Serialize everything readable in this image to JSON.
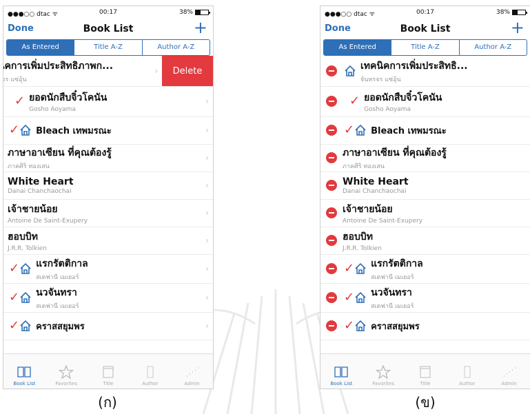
{
  "status": {
    "carrier": "●●●○○ dtac ᯤ",
    "time": "00:17",
    "battery": "38%",
    "battery_fraction": 0.38
  },
  "nav": {
    "done": "Done",
    "title": "Book List",
    "add": "+"
  },
  "segments": [
    "As Entered",
    "Title A-Z",
    "Author A-Z"
  ],
  "delete_label": "Delete",
  "screen_a": {
    "caption": "(ก)",
    "books": [
      {
        "title": "นิคการเพิ่มประสิทธิภาพก...",
        "subtitle": "ยจร แซ่อุ้น",
        "read": false,
        "owned": false
      },
      {
        "title": "ยอดนักสืบจิ๋วโคนัน",
        "subtitle": "Gosho Aoyama",
        "read": true,
        "owned": false
      },
      {
        "title": "Bleach เทพมรณะ",
        "subtitle": "",
        "read": true,
        "owned": true
      },
      {
        "title": "ภาษาอาเซียน ที่คุณต้องรู้",
        "subtitle": "ภาคศิริ ทองเสน",
        "read": false,
        "owned": false
      },
      {
        "title": "White Heart",
        "subtitle": "Danai Chanchaochai",
        "read": false,
        "owned": false
      },
      {
        "title": "เจ้าชายน้อย",
        "subtitle": "Antoine De Saint-Exupery",
        "read": false,
        "owned": false
      },
      {
        "title": "ฮอบบิท",
        "subtitle": "J.R.R. Tolkien",
        "read": false,
        "owned": false
      },
      {
        "title": "แรกรัตติกาล",
        "subtitle": "สเตฟานี เมเยอร์",
        "read": true,
        "owned": true
      },
      {
        "title": "นวจันทรา",
        "subtitle": "สเตฟานี เมเยอร์",
        "read": true,
        "owned": true
      },
      {
        "title": "คราสสยุมพร",
        "subtitle": "",
        "read": true,
        "owned": true
      }
    ]
  },
  "screen_b": {
    "caption": "(ข)",
    "books": [
      {
        "title": "เทคนิคการเพิ่มประสิทธิ...",
        "subtitle": "จันทรจร แซ่อุ้น",
        "read": false,
        "owned": true
      },
      {
        "title": "ยอดนักสืบจิ๋วโคนัน",
        "subtitle": "Gosho Aoyama",
        "read": true,
        "owned": false
      },
      {
        "title": "Bleach เทพมรณะ",
        "subtitle": "",
        "read": true,
        "owned": true
      },
      {
        "title": "ภาษาอาเซียน ที่คุณต้องรู้",
        "subtitle": "ภาคศิริ ทองเสน",
        "read": false,
        "owned": false
      },
      {
        "title": "White Heart",
        "subtitle": "Danai Chanchaochai",
        "read": false,
        "owned": false
      },
      {
        "title": "เจ้าชายน้อย",
        "subtitle": "Antoine De Saint-Exupery",
        "read": false,
        "owned": false
      },
      {
        "title": "ฮอบบิท",
        "subtitle": "J.R.R. Tolkien",
        "read": false,
        "owned": false
      },
      {
        "title": "แรกรัตติกาล",
        "subtitle": "สเตฟานี เมเยอร์",
        "read": true,
        "owned": true
      },
      {
        "title": "นวจันทรา",
        "subtitle": "สเตฟานี เมเยอร์",
        "read": true,
        "owned": true
      },
      {
        "title": "คราสสยุมพร",
        "subtitle": "",
        "read": true,
        "owned": true
      }
    ]
  },
  "tabs": [
    {
      "label": "Book List",
      "icon": "book-icon"
    },
    {
      "label": "Favorites",
      "icon": "star-icon"
    },
    {
      "label": "Title",
      "icon": "title-icon"
    },
    {
      "label": "Author",
      "icon": "author-icon"
    },
    {
      "label": "Admin",
      "icon": "admin-icon"
    }
  ],
  "colors": {
    "accent": "#2e6fb7",
    "delete": "#e23a3e",
    "check": "#e03a3a"
  }
}
